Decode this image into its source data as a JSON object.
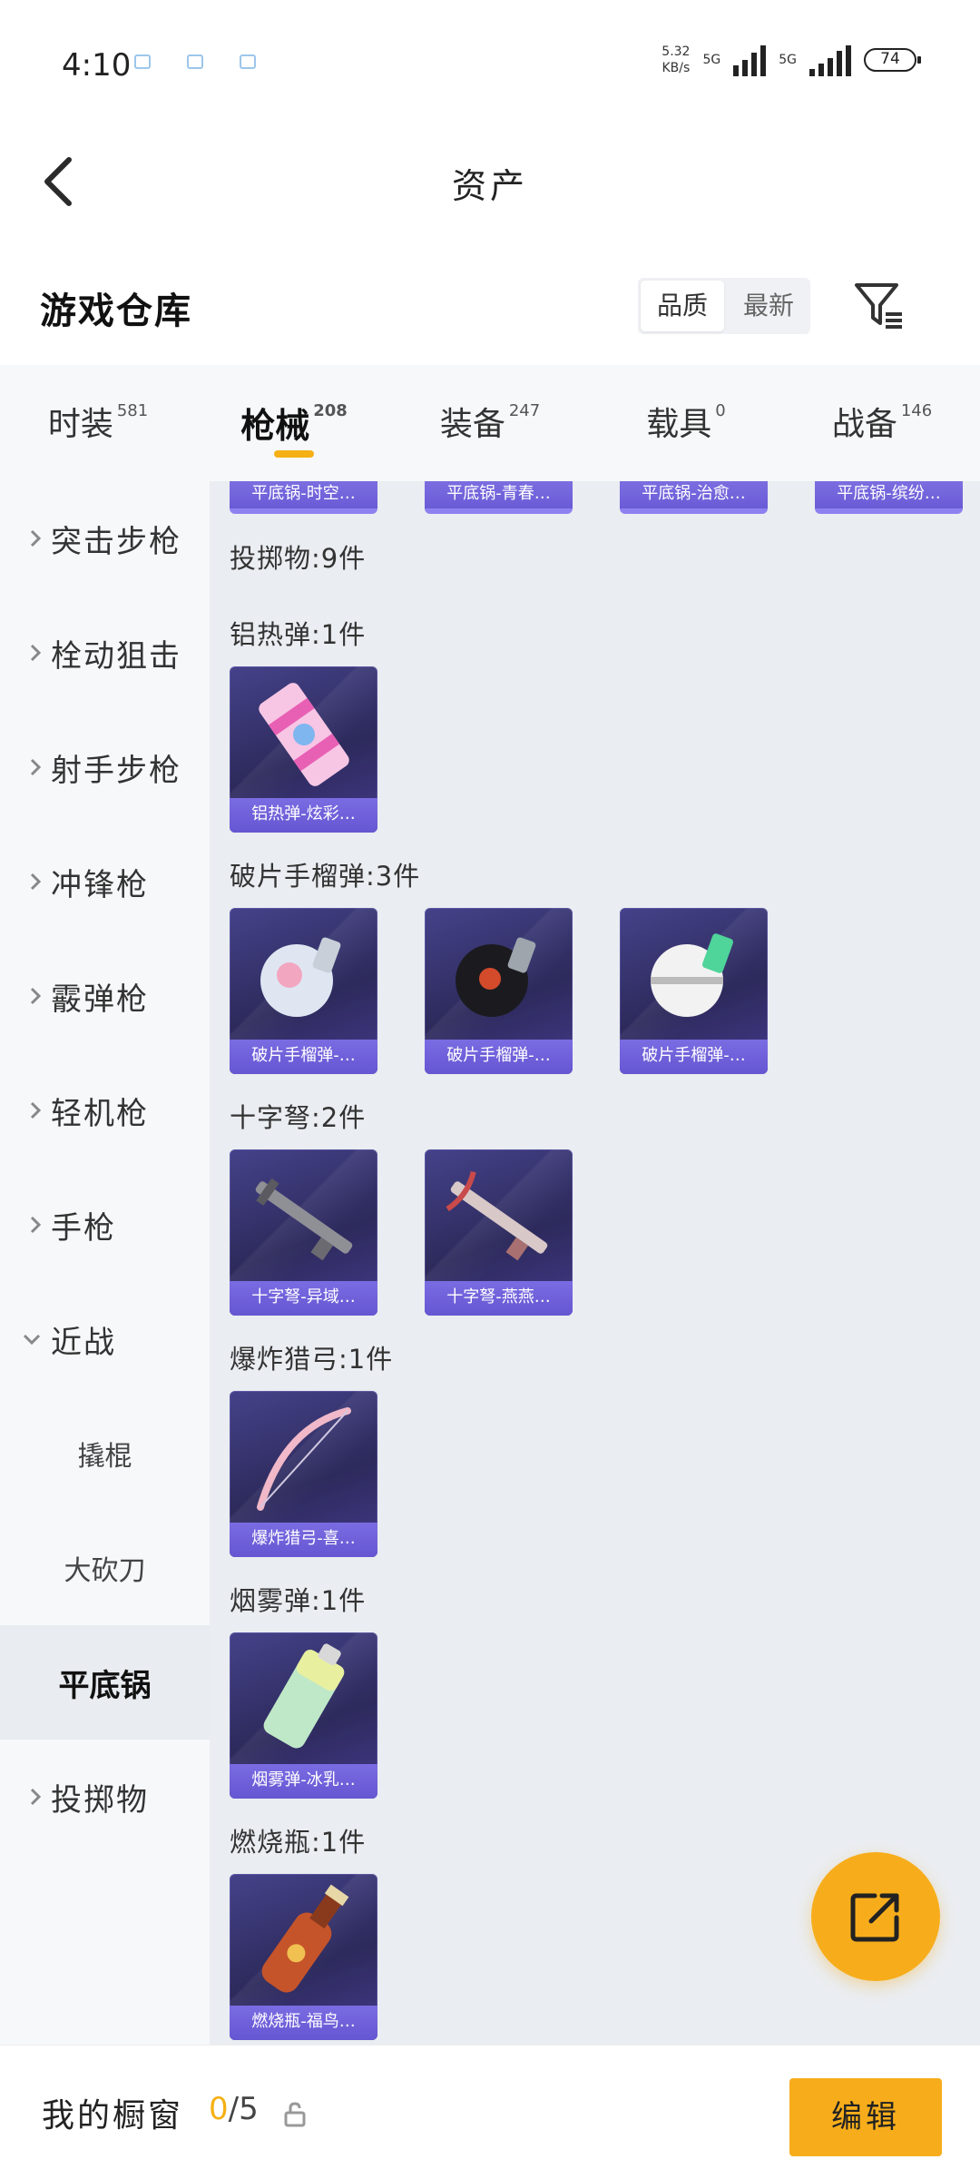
{
  "status_bar": {
    "time": "4:10",
    "net_speed_value": "5.32",
    "net_speed_unit": "KB/s",
    "net1": "5G",
    "net2": "5G",
    "battery": "74"
  },
  "header": {
    "title": "资产",
    "back_icon": "chevron-left-icon"
  },
  "warehouse": {
    "title": "游戏仓库",
    "sort_options": [
      "品质",
      "最新"
    ],
    "sort_selected": "品质",
    "filter_icon": "filter-icon"
  },
  "tabs": [
    {
      "label": "时装",
      "count": "581"
    },
    {
      "label": "枪械",
      "count": "208",
      "active": true
    },
    {
      "label": "装备",
      "count": "247"
    },
    {
      "label": "载具",
      "count": "0"
    },
    {
      "label": "战备",
      "count": "146"
    }
  ],
  "sidebar": {
    "items": [
      {
        "label": "突击步枪"
      },
      {
        "label": "栓动狙击"
      },
      {
        "label": "射手步枪"
      },
      {
        "label": "冲锋枪"
      },
      {
        "label": "霰弹枪"
      },
      {
        "label": "轻机枪"
      },
      {
        "label": "手枪"
      },
      {
        "label": "近战"
      },
      {
        "label": "撬棍"
      },
      {
        "label": "大砍刀"
      },
      {
        "label": "平底锅"
      },
      {
        "label": "投掷物"
      }
    ]
  },
  "top_strip": [
    "平底锅-时空…",
    "平底锅-青春…",
    "平底锅-治愈…",
    "平底锅-缤纷…"
  ],
  "content": {
    "section_title": "投掷物:9件",
    "categories": [
      {
        "title": "铝热弹:1件",
        "items": [
          "铝热弹-炫彩…"
        ]
      },
      {
        "title": "破片手榴弹:3件",
        "items": [
          "破片手榴弹-…",
          "破片手榴弹-…",
          "破片手榴弹-…"
        ]
      },
      {
        "title": "十字弩:2件",
        "items": [
          "十字弩-异域…",
          "十字弩-燕燕…"
        ]
      },
      {
        "title": "爆炸猎弓:1件",
        "items": [
          "爆炸猎弓-喜…"
        ]
      },
      {
        "title": "烟雾弹:1件",
        "items": [
          "烟雾弹-冰乳…"
        ]
      },
      {
        "title": "燃烧瓶:1件",
        "items": [
          "燃烧瓶-福鸟…"
        ]
      }
    ]
  },
  "fab": {
    "icon": "share-icon"
  },
  "bottom_bar": {
    "showcase_label": "我的橱窗",
    "showcase_current": "0",
    "showcase_total": "/5",
    "lock_icon": "lock-icon",
    "edit_label": "编辑"
  },
  "colors": {
    "accent": "#f7ad1b",
    "card_bg": "#2d2a5c",
    "card_caption": "#6a5bd6"
  }
}
